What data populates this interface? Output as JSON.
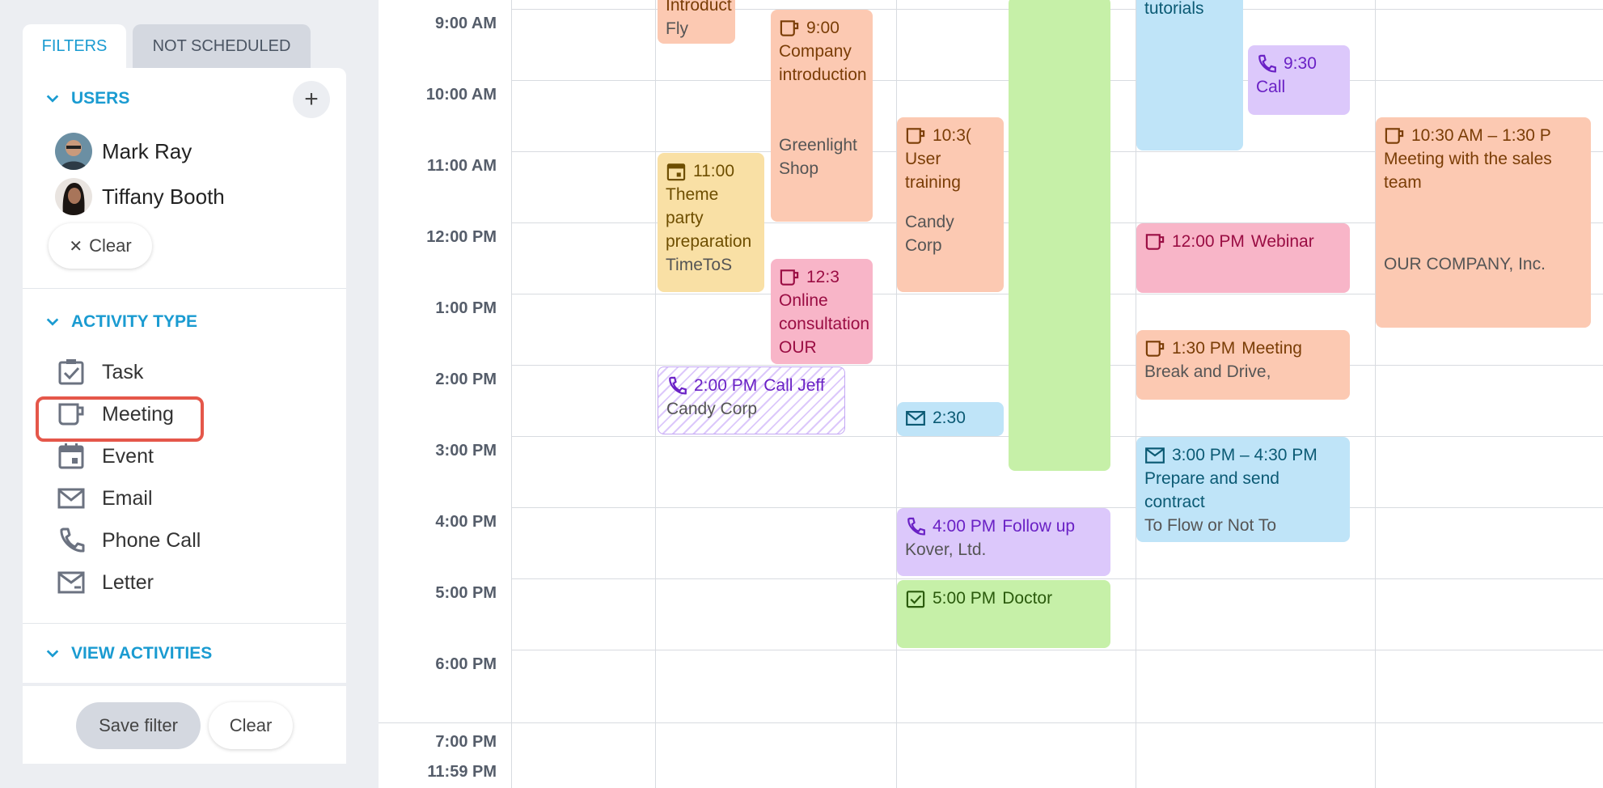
{
  "tabs": {
    "filters": "FILTERS",
    "not_scheduled": "NOT SCHEDULED"
  },
  "users_section": {
    "title": "USERS",
    "add_label": "+",
    "users": [
      {
        "name": "Mark Ray"
      },
      {
        "name": "Tiffany Booth"
      }
    ],
    "clear_label": "Clear"
  },
  "activity_section": {
    "title": "ACTIVITY TYPE",
    "types": [
      {
        "label": "Task",
        "icon": "task-icon"
      },
      {
        "label": "Meeting",
        "icon": "meeting-icon"
      },
      {
        "label": "Event",
        "icon": "event-icon"
      },
      {
        "label": "Email",
        "icon": "email-icon"
      },
      {
        "label": "Phone Call",
        "icon": "phone-icon"
      },
      {
        "label": "Letter",
        "icon": "letter-icon"
      }
    ],
    "highlighted": "Meeting"
  },
  "view_section": {
    "title": "VIEW ACTIVITIES"
  },
  "footer": {
    "save_label": "Save filter",
    "clear_label": "Clear"
  },
  "times": [
    "9:00 AM",
    "10:00 AM",
    "11:00 AM",
    "12:00 PM",
    "1:00 PM",
    "2:00 PM",
    "3:00 PM",
    "4:00 PM",
    "5:00 PM",
    "6:00 PM",
    "7:00 PM",
    "11:59 PM"
  ],
  "events": {
    "e1": {
      "title": "Introduct",
      "sub": "Fly Logistics"
    },
    "e2": {
      "time": "9:00",
      "title": "Company introduction",
      "sub": "Greenlight Shop"
    },
    "e3": {
      "time": "11:00",
      "title": "Theme party preparation",
      "sub": "TimeToS"
    },
    "e4": {
      "time": "12:3",
      "title": "Online consultation",
      "sub": "OUR"
    },
    "e5": {
      "time": "2:00 PM",
      "title": "Call Jeff",
      "sub": "Candy Corp"
    },
    "e6": {
      "time": "10:3(",
      "title": "User training",
      "sub": "Candy Corp"
    },
    "e7": {
      "time": "2:30"
    },
    "e8": {
      "time": "4:00 PM",
      "title": "Follow up",
      "sub": "Kover, Ltd."
    },
    "e9": {
      "time": "5:00 PM",
      "title": "Doctor"
    },
    "e10": {
      "title": "tutorials"
    },
    "e11": {
      "time": "9:30",
      "title": "Call"
    },
    "e12": {
      "time": "12:00 PM",
      "title": "Webinar"
    },
    "e13": {
      "time": "1:30 PM",
      "title": "Meeting",
      "sub": "Break and Drive,"
    },
    "e14": {
      "time": "3:00 PM – 4:30 PM",
      "title": "Prepare and send contract",
      "sub": "To Flow or Not To"
    },
    "e15": {
      "time": "10:30 AM – 1:30 P",
      "title": "Meeting with the sales team",
      "sub": "OUR COMPANY, Inc."
    }
  },
  "colors": {
    "accent": "#1a9bd1",
    "highlight": "#e5574a"
  }
}
